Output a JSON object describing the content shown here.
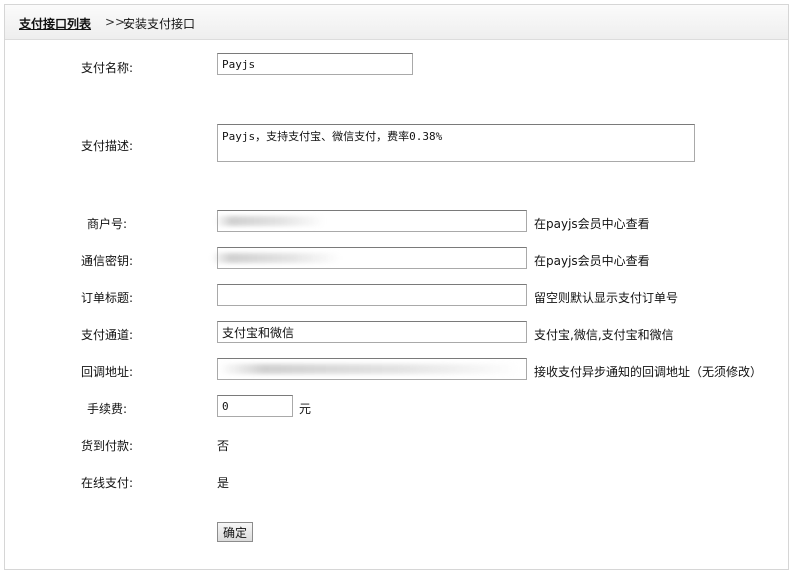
{
  "breadcrumb": {
    "list_link": "支付接口列表",
    "separator": ">>",
    "current": "安装支付接口"
  },
  "form": {
    "pay_name": {
      "label": "支付名称:",
      "value": "Payjs"
    },
    "pay_desc": {
      "label": "支付描述:",
      "value": "Payjs，支持支付宝、微信支付，费率0.38%"
    },
    "merchant_id": {
      "label": "商户号:",
      "hint": "在payjs会员中心查看"
    },
    "secret_key": {
      "label": "通信密钥:",
      "hint": "在payjs会员中心查看"
    },
    "order_title": {
      "label": "订单标题:",
      "value": "",
      "hint": "留空则默认显示支付订单号"
    },
    "channel": {
      "label": "支付通道:",
      "value": "支付宝和微信",
      "hint": "支付宝,微信,支付宝和微信"
    },
    "callback_url": {
      "label": "回调地址:",
      "hint": "接收支付异步通知的回调地址（无须修改）"
    },
    "fee": {
      "label": "手续费:",
      "value": "0",
      "unit": "元"
    },
    "cod": {
      "label": "货到付款:",
      "value": "否"
    },
    "online": {
      "label": "在线支付:",
      "value": "是"
    },
    "submit_label": "确定"
  }
}
